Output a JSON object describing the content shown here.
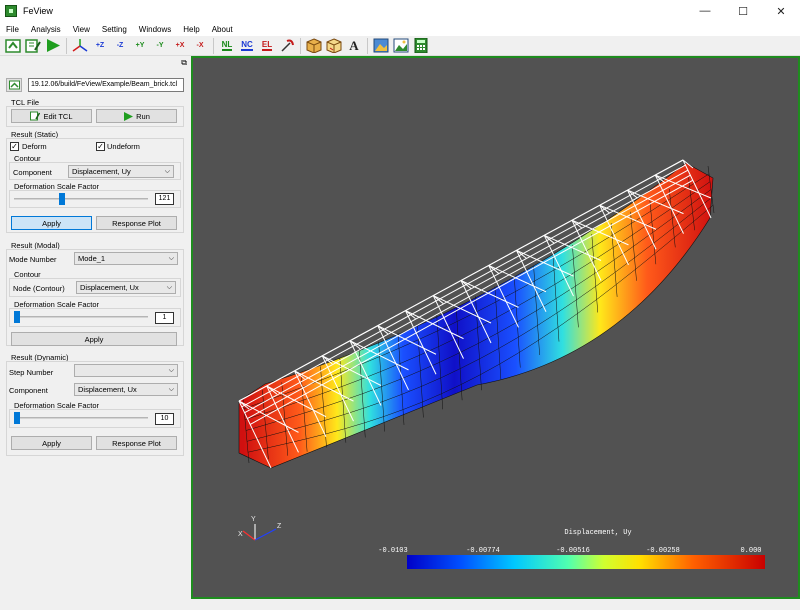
{
  "window": {
    "title": "FeView",
    "minimize": "—",
    "maximize": "☐",
    "close": "✕"
  },
  "menu": [
    "File",
    "Analysis",
    "View",
    "Setting",
    "Windows",
    "Help",
    "About"
  ],
  "toolbar": {
    "z_plus": "+Z",
    "z_minus": "-Z",
    "y_plus": "+Y",
    "y_minus": "-Y",
    "x_plus": "+X",
    "x_minus": "-X",
    "nl": "NL",
    "nc": "NC",
    "el": "EL",
    "text_a": "A"
  },
  "panel": {
    "tcl_path": "19.12.06/build/FeView/Example/Beam_brick.tcl",
    "tcl_file_label": "TCL File",
    "edit_tcl": "Edit TCL",
    "run": "Run",
    "static": {
      "title": "Result (Static)",
      "deform": "Deform",
      "undeform": "Undeform",
      "deform_checked": true,
      "undeform_checked": true,
      "contour_title": "Contour",
      "component_label": "Component",
      "component_value": "Displacement, Uy",
      "scale_title": "Deformation Scale Factor",
      "scale_value": "121",
      "scale_fraction": 0.12,
      "apply": "Apply",
      "response_plot": "Response Plot"
    },
    "modal": {
      "title": "Result (Modal)",
      "mode_label": "Mode Number",
      "mode_value": "Mode_1",
      "contour_title": "Contour",
      "node_label": "Node (Contour)",
      "node_value": "Displacement, Ux",
      "scale_title": "Deformation Scale Factor",
      "scale_value": "1",
      "scale_fraction": 0.0,
      "apply": "Apply"
    },
    "dynamic": {
      "title": "Result (Dynamic)",
      "step_label": "Step Number",
      "step_value": "",
      "component_label": "Component",
      "component_value": "Displacement, Ux",
      "scale_title": "Deformation Scale Factor",
      "scale_value": "10",
      "scale_fraction": 0.0,
      "apply": "Apply",
      "response_plot": "Response Plot"
    }
  },
  "viewport": {
    "axes": {
      "x": "X",
      "y": "Y",
      "z": "Z"
    },
    "legend": {
      "title": "Displacement, Uy",
      "ticks": [
        "-0.0103",
        "-0.00774",
        "-0.00516",
        "-0.00258",
        "0.000"
      ]
    }
  }
}
